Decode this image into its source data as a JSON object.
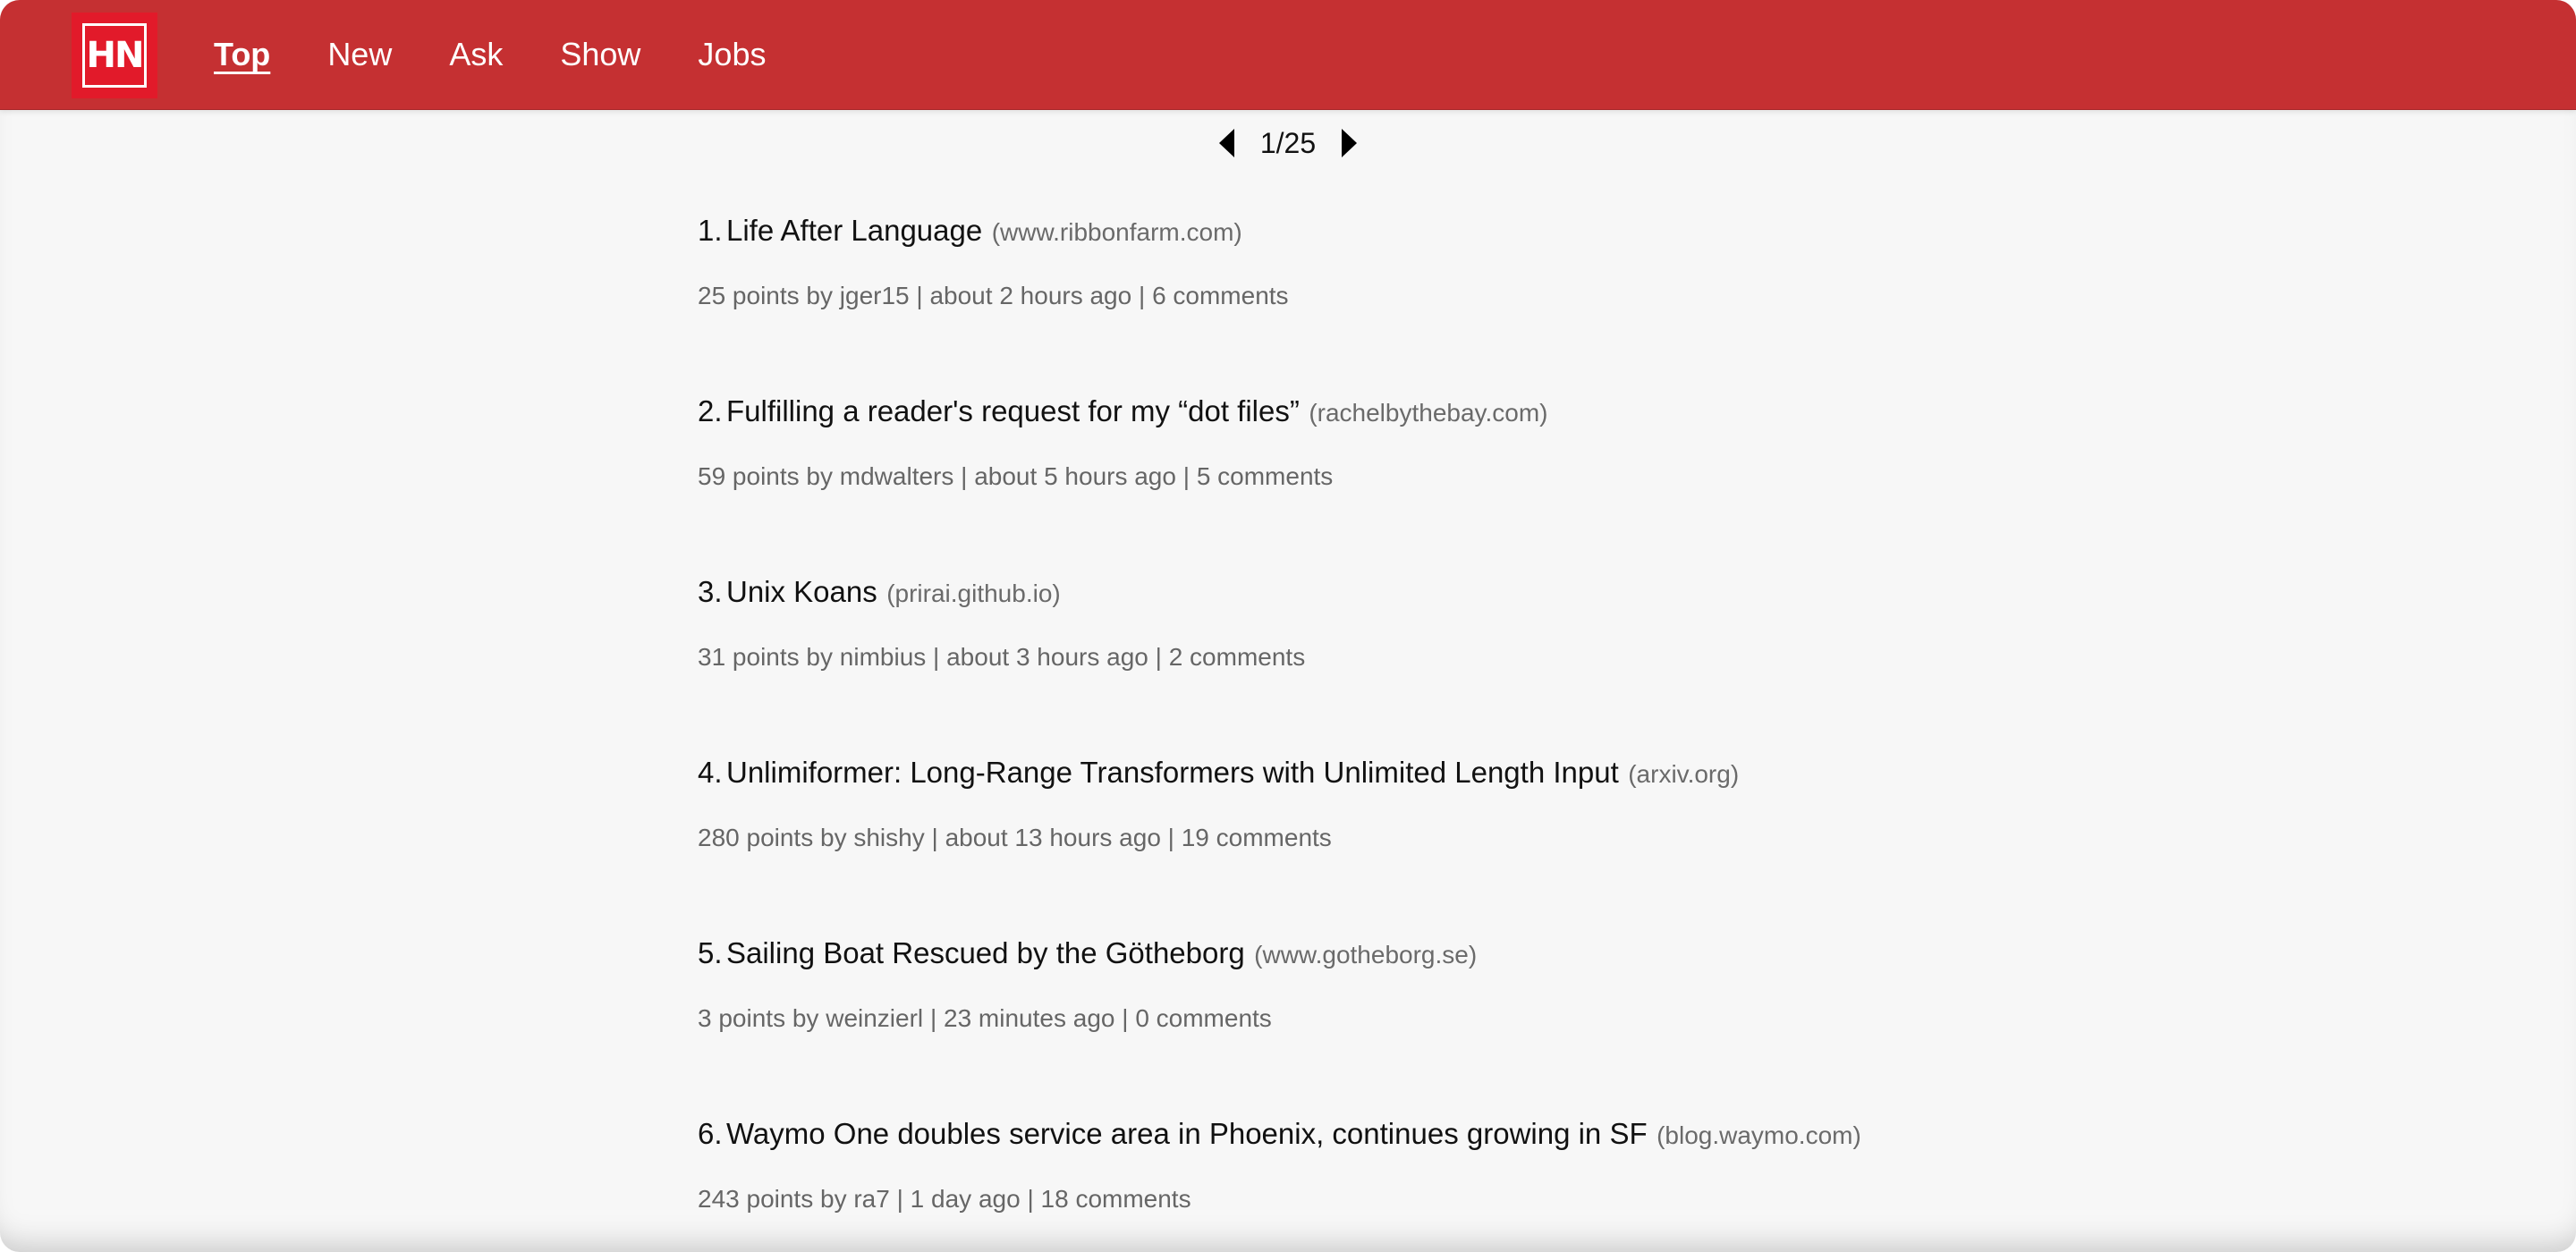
{
  "header": {
    "logo_text": "HN",
    "nav": [
      {
        "label": "Top",
        "active": true
      },
      {
        "label": "New",
        "active": false
      },
      {
        "label": "Ask",
        "active": false
      },
      {
        "label": "Show",
        "active": false
      },
      {
        "label": "Jobs",
        "active": false
      }
    ]
  },
  "pagination": {
    "label": "1/25",
    "prev_icon": "triangle-left-icon",
    "next_icon": "triangle-right-icon"
  },
  "stories": [
    {
      "rank": "1.",
      "title": "Life After Language",
      "site": "(www.ribbonfarm.com)",
      "points": "25 points",
      "by_prefix": "by",
      "author": "jger15",
      "time": "about 2 hours ago",
      "comments": "6 comments"
    },
    {
      "rank": "2.",
      "title": "Fulfilling a reader's request for my “dot files”",
      "site": "(rachelbythebay.com)",
      "points": "59 points",
      "by_prefix": "by",
      "author": "mdwalters",
      "time": "about 5 hours ago",
      "comments": "5 comments"
    },
    {
      "rank": "3.",
      "title": "Unix Koans",
      "site": "(prirai.github.io)",
      "points": "31 points",
      "by_prefix": "by",
      "author": "nimbius",
      "time": "about 3 hours ago",
      "comments": "2 comments"
    },
    {
      "rank": "4.",
      "title": "Unlimiformer: Long-Range Transformers with Unlimited Length Input",
      "site": "(arxiv.org)",
      "points": "280 points",
      "by_prefix": "by",
      "author": "shishy",
      "time": "about 13 hours ago",
      "comments": "19 comments"
    },
    {
      "rank": "5.",
      "title": "Sailing Boat Rescued by the Götheborg",
      "site": "(www.gotheborg.se)",
      "points": "3 points",
      "by_prefix": "by",
      "author": "weinzierl",
      "time": "23 minutes ago",
      "comments": "0 comments"
    },
    {
      "rank": "6.",
      "title": "Waymo One doubles service area in Phoenix, continues growing in SF",
      "site": "(blog.waymo.com)",
      "points": "243 points",
      "by_prefix": "by",
      "author": "ra7",
      "time": "1 day ago",
      "comments": "18 comments"
    }
  ],
  "colors": {
    "header_bg": "#c53032",
    "logo_bg": "#e21a2a",
    "page_bg": "#f7f7f7",
    "title_text": "#111111",
    "meta_text": "#666666"
  }
}
